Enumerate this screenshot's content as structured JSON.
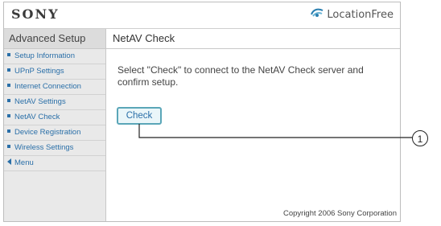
{
  "header": {
    "brand": "SONY",
    "product_logo_text": "LocationFree"
  },
  "sidebar": {
    "title": "Advanced Setup",
    "items": [
      {
        "label": "Setup Information"
      },
      {
        "label": "UPnP Settings"
      },
      {
        "label": "Internet Connection"
      },
      {
        "label": "NetAV Settings"
      },
      {
        "label": "NetAV Check"
      },
      {
        "label": "Device Registration"
      },
      {
        "label": "Wireless Settings"
      }
    ],
    "menu_label": "Menu"
  },
  "main": {
    "title": "NetAV Check",
    "description": "Select \"Check\" to connect to the NetAV Check server and confirm setup.",
    "check_button_label": "Check",
    "copyright": "Copyright 2006 Sony Corporation"
  },
  "callout": {
    "number": "1"
  },
  "colors": {
    "link": "#2a6fa8",
    "button_border": "#5aa6b8",
    "sidebar_bg": "#e9e9e9"
  }
}
